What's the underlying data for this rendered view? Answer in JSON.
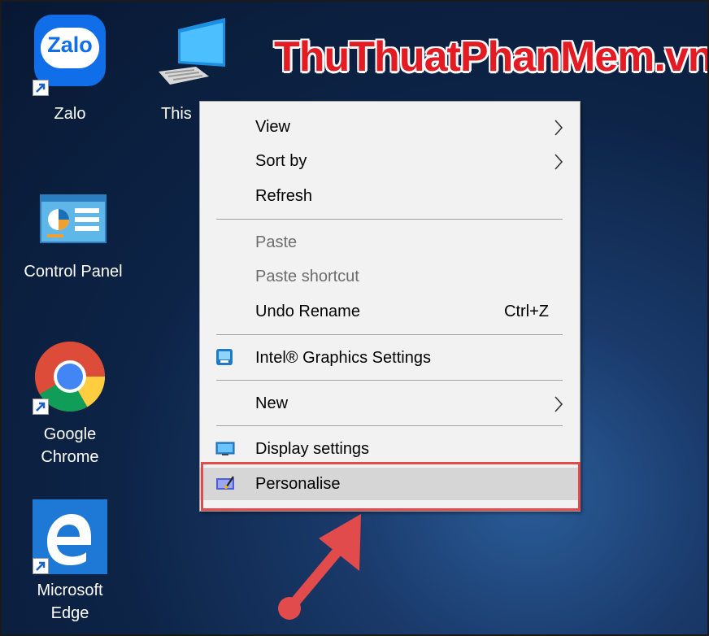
{
  "watermark": "ThuThuatPhanMem.vn",
  "desktop_icons": {
    "zalo": {
      "label": "Zalo",
      "logo_text": "Zalo"
    },
    "this_pc": {
      "label": "This"
    },
    "control_panel": {
      "label": "Control Panel"
    },
    "chrome": {
      "label_line1": "Google",
      "label_line2": "Chrome"
    },
    "edge": {
      "label_line1": "Microsoft",
      "label_line2": "Edge"
    }
  },
  "context_menu": {
    "view": "View",
    "sort_by": "Sort by",
    "refresh": "Refresh",
    "paste": "Paste",
    "paste_shortcut": "Paste shortcut",
    "undo_rename": "Undo Rename",
    "undo_shortcut": "Ctrl+Z",
    "intel_graphics": "Intel® Graphics Settings",
    "new": "New",
    "display_settings": "Display settings",
    "personalise": "Personalise"
  },
  "colors": {
    "highlight_box": "#e14b4b",
    "arrow": "#e14b4b",
    "watermark": "#e31b23"
  }
}
